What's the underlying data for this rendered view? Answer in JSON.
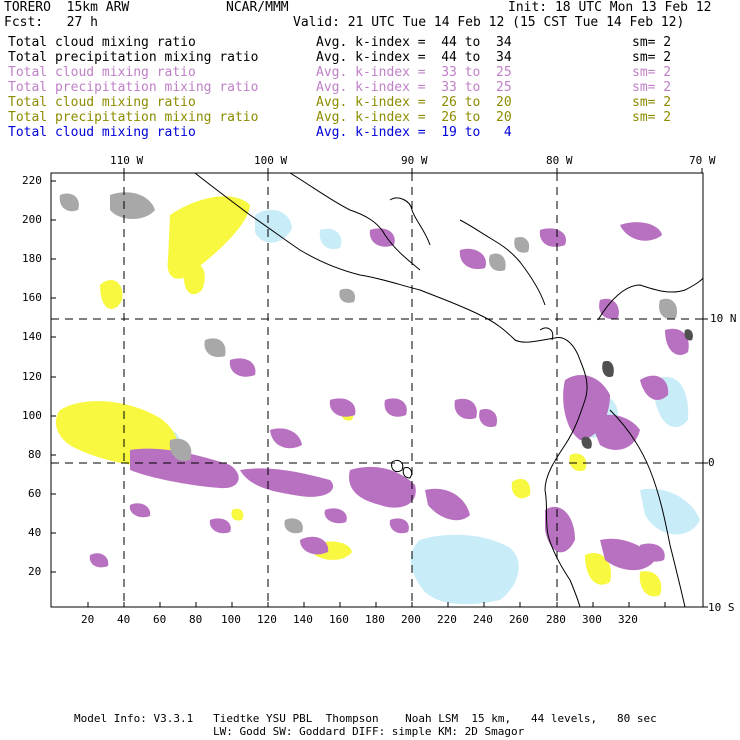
{
  "header": {
    "model": "TORERO  15km ARW",
    "org": "NCAR/MMM",
    "init": "Init: 18 UTC Mon 13 Feb 12",
    "fcst": "Fcst:   27 h",
    "valid": "Valid: 21 UTC Tue 14 Feb 12 (15 CST Tue 14 Feb 12)"
  },
  "legend": [
    {
      "field": "Total cloud mixing ratio",
      "kindex": "Avg. k-index =  44 to  34",
      "sm": "sm= 2",
      "color": "#000000"
    },
    {
      "field": "Total precipitation mixing ratio",
      "kindex": "Avg. k-index =  44 to  34",
      "sm": "sm= 2",
      "color": "#000000"
    },
    {
      "field": "Total cloud mixing ratio",
      "kindex": "Avg. k-index =  33 to  25",
      "sm": "sm= 2",
      "color": "#c080c8"
    },
    {
      "field": "Total precipitation mixing ratio",
      "kindex": "Avg. k-index =  33 to  25",
      "sm": "sm= 2",
      "color": "#c080c8"
    },
    {
      "field": "Total cloud mixing ratio",
      "kindex": "Avg. k-index =  26 to  20",
      "sm": "sm= 2",
      "color": "#8c8c00"
    },
    {
      "field": "Total precipitation mixing ratio",
      "kindex": "Avg. k-index =  26 to  20",
      "sm": "sm= 2",
      "color": "#8c8c00"
    },
    {
      "field": "Total cloud mixing ratio",
      "kindex": "Avg. k-index =  19 to   4",
      "sm": "",
      "color": "#0000d8"
    }
  ],
  "axes": {
    "top_lon": [
      "110 W",
      "100 W",
      "90 W",
      "80 W",
      "70 W"
    ],
    "right_lat": [
      "10 N",
      "0",
      "10 S"
    ],
    "x_ticks": [
      "20",
      "40",
      "60",
      "80",
      "100",
      "120",
      "140",
      "160",
      "180",
      "200",
      "220",
      "240",
      "260",
      "280",
      "300",
      "320"
    ],
    "y_ticks": [
      "20",
      "40",
      "60",
      "80",
      "100",
      "120",
      "140",
      "160",
      "180",
      "200",
      "220"
    ]
  },
  "footer": {
    "line1": "Model Info: V3.3.1   Tiedtke YSU PBL  Thompson    Noah LSM  15 km,   44 levels,   80 sec",
    "line2": "LW: Godd SW: Goddard DIFF: simple KM: 2D Smagor"
  },
  "colors": {
    "purple": "#b871c0",
    "yellow": "#f8f840",
    "lightblue": "#c8ecf8",
    "gray": "#a8a8a8",
    "darkgray": "#505050"
  }
}
